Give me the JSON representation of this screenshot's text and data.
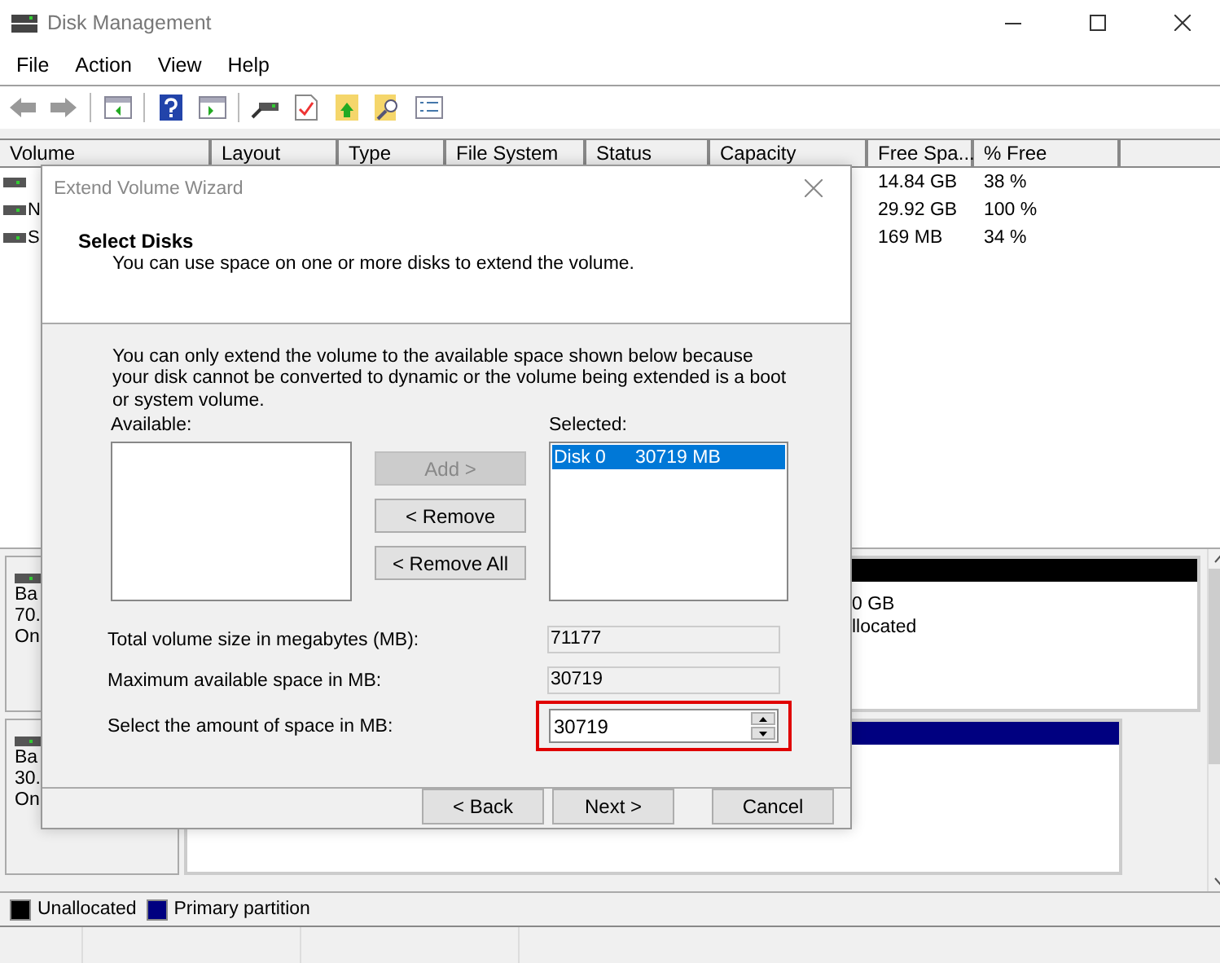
{
  "window": {
    "title": "Disk Management"
  },
  "menu": [
    "File",
    "Action",
    "View",
    "Help"
  ],
  "volumes": {
    "columns": [
      "Volume",
      "Layout",
      "Type",
      "File System",
      "Status",
      "Capacity",
      "Free Spa...",
      "% Free"
    ],
    "rows": [
      {
        "free_space": "14.84 GB",
        "percent_free": "38 %"
      },
      {
        "volume": "N",
        "free_space": "29.92 GB",
        "percent_free": "100 %"
      },
      {
        "volume": "S",
        "free_space": "169 MB",
        "percent_free": "34 %"
      }
    ]
  },
  "disks": [
    {
      "label_lines": [
        "Ba",
        "70.",
        "On"
      ],
      "partition": {
        "kind": "unallocated",
        "lines": [
          "0 GB",
          "llocated"
        ]
      }
    },
    {
      "label_lines": [
        "Ba",
        "30.",
        "On"
      ],
      "partition": {
        "kind": "primary"
      }
    }
  ],
  "legend": [
    {
      "label": "Unallocated",
      "color": "#000000"
    },
    {
      "label": "Primary partition",
      "color": "#000080"
    }
  ],
  "dialog": {
    "title": "Extend Volume Wizard",
    "heading": "Select Disks",
    "subheading": "You can use space on one or more disks to extend the volume.",
    "note": "You can only extend the volume to the available space shown below because your disk cannot be converted to dynamic or the volume being extended is a boot or system volume.",
    "available_label": "Available:",
    "selected_label": "Selected:",
    "selected_items": [
      {
        "disk": "Disk 0",
        "size": "30719 MB",
        "selected": true
      }
    ],
    "move_buttons": [
      {
        "label": "Add >",
        "disabled": true
      },
      {
        "label": "< Remove",
        "disabled": false
      },
      {
        "label": "< Remove All",
        "disabled": false
      }
    ],
    "fields": [
      {
        "kind": "readonly",
        "label": "Total volume size in megabytes (MB):",
        "value": "71177"
      },
      {
        "kind": "readonly",
        "label": "Maximum available space in MB:",
        "value": "30719"
      },
      {
        "kind": "spinner",
        "label": "Select the amount of space in MB:",
        "value": "30719",
        "highlighted": true
      }
    ],
    "footer_buttons": [
      "< Back",
      "Next >",
      "Cancel"
    ]
  }
}
